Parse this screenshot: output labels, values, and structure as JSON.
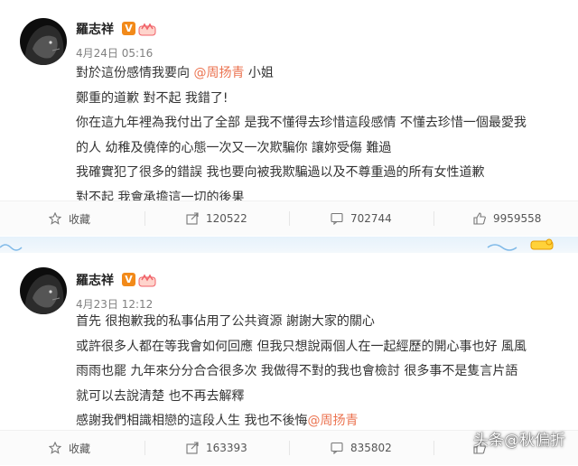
{
  "posts": [
    {
      "author": "羅志祥",
      "verified_badge": "V",
      "time": "4月24日 05:16",
      "lines": [
        {
          "text": "對於這份感情我要向",
          "mention": "@周扬青",
          "after": " 小姐"
        },
        {
          "text": "鄭重的道歉 對不起 我錯了!"
        },
        {
          "text": "你在這九年裡為我付出了全部 是我不懂得去珍惜這段感情 不懂去珍惜一個最愛我"
        },
        {
          "text": "的人 幼稚及僥倖的心態一次又一次欺騙你 讓妳受傷 難過"
        },
        {
          "text": "我確實犯了很多的錯誤 我也要向被我欺騙過以及不尊重過的所有女性道歉"
        },
        {
          "text": "對不起   我會承擔這一切的後果"
        }
      ],
      "actions": {
        "favorite": "收藏",
        "repost": "120522",
        "comment": "702744",
        "like": "9959558"
      }
    },
    {
      "author": "羅志祥",
      "verified_badge": "V",
      "time": "4月23日 12:12",
      "lines": [
        {
          "text": "首先 很抱歉我的私事佔用了公共資源 謝謝大家的關心"
        },
        {
          "text": "或許很多人都在等我會如何回應 但我只想說兩個人在一起經歷的開心事也好 風風"
        },
        {
          "text": "雨雨也罷 九年來分分合合很多次 我做得不對的我也會檢討 很多事不是隻言片語"
        },
        {
          "text": "就可以去說清楚 也不再去解釋"
        },
        {
          "text": "感謝我們相識相戀的這段人生 我也不後悔",
          "mention": "@周扬青",
          "after": ""
        }
      ],
      "actions": {
        "favorite": "收藏",
        "repost": "163393",
        "comment": "835802",
        "like": ""
      }
    }
  ],
  "icons": {
    "favorite": "star-icon",
    "repost": "repost-icon",
    "comment": "comment-icon",
    "like": "thumbs-up-icon",
    "avatar": "lion-avatar",
    "badge_extra": "crown-icon",
    "band_decoration": "duck-icon"
  },
  "colors": {
    "mention": "#eb7350",
    "badge": "#f28a1a",
    "band": "#e6f2fb"
  },
  "watermark": "头条@秋偏折"
}
